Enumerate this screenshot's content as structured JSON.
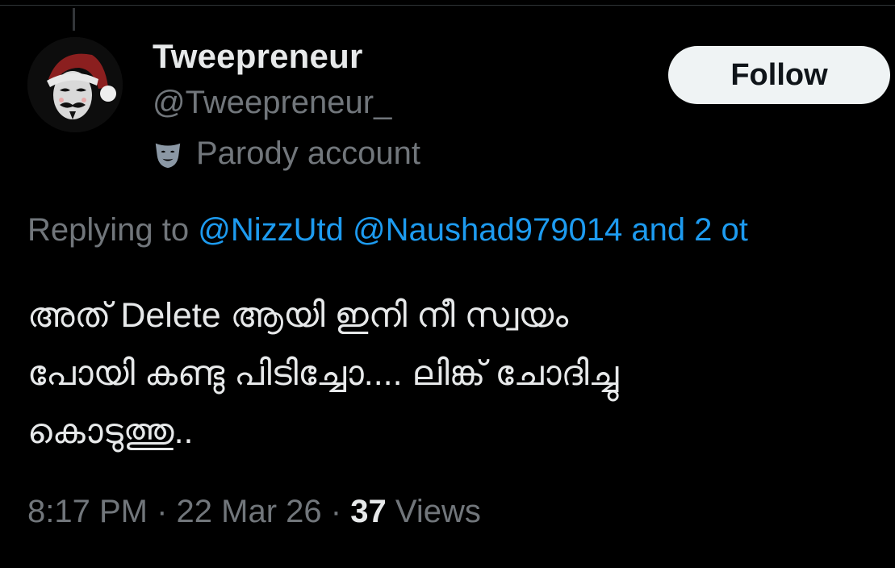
{
  "author": {
    "display_name": "Tweepreneur",
    "handle": "@Tweepreneur_",
    "label_icon": "theater-mask-icon",
    "label_text": "Parody account"
  },
  "follow_button": {
    "label": "Follow"
  },
  "reply": {
    "prefix": "Replying to",
    "mentions": [
      "@NizzUtd",
      "@Naushad979014"
    ],
    "suffix": "and 2 ot"
  },
  "tweet": {
    "text": "അത് Delete ആയി ഇനി നീ സ്വയം\nപോയി കണ്ടു പിടിച്ചോ.... ലിങ്ക് ചോദിച്ചു\nകൊടുത്തു.."
  },
  "meta": {
    "time": "8:17 PM",
    "date": "22 Mar 26",
    "separator": "·",
    "views_count": "37",
    "views_label": "Views"
  },
  "colors": {
    "background": "#000000",
    "primary_text": "#e7e9ea",
    "secondary_text": "#71767b",
    "link": "#1d9bf0",
    "follow_bg": "#eff3f4",
    "follow_text": "#0f1419",
    "avatar_hat": "#8b1f1f"
  }
}
